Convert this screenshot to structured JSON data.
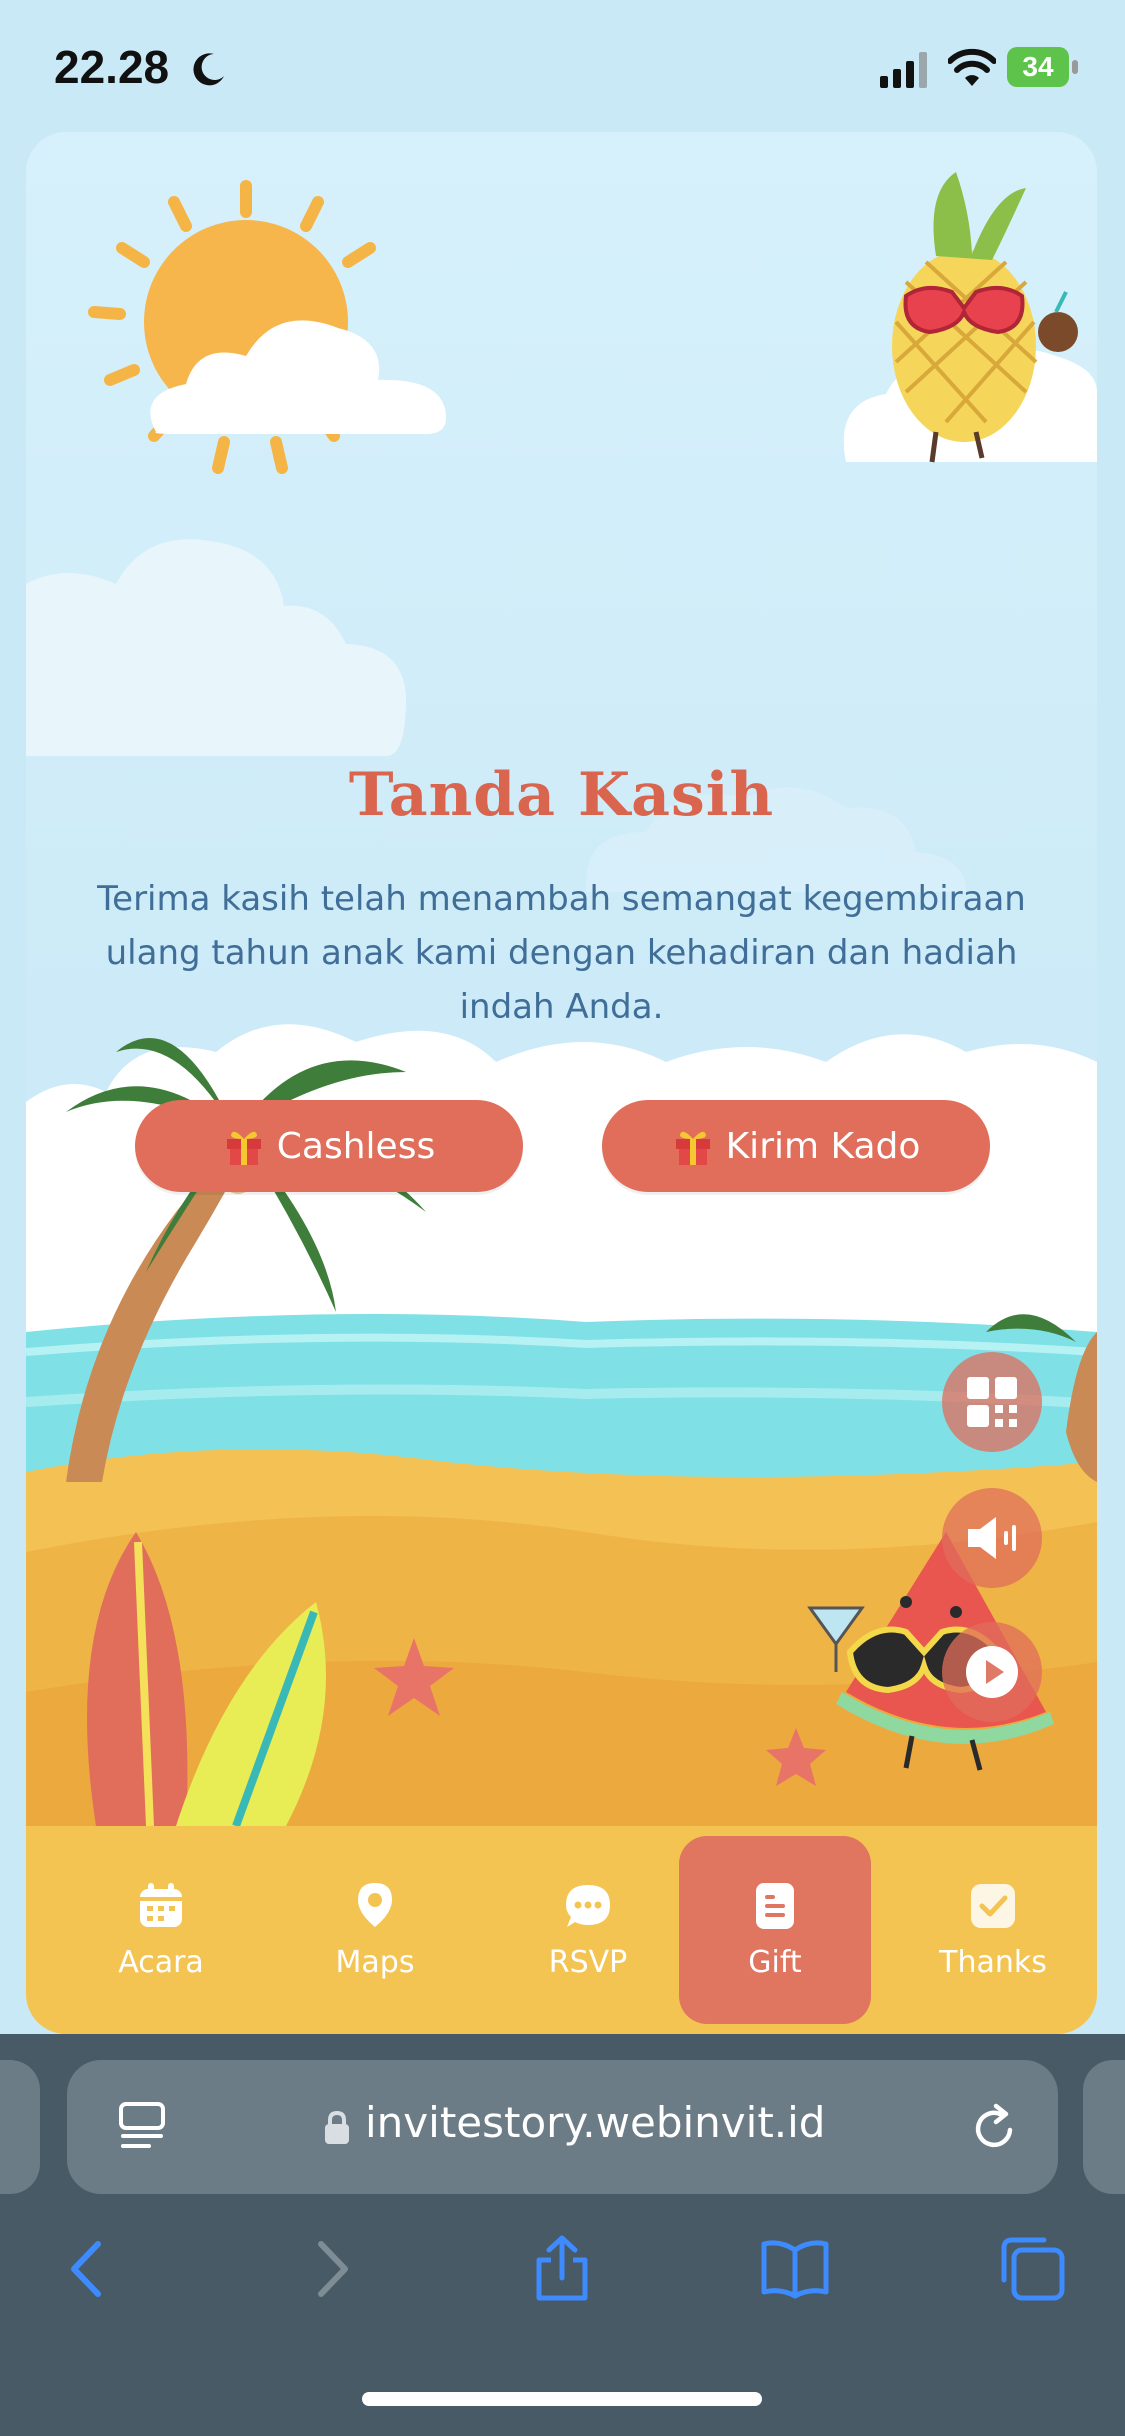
{
  "status_bar": {
    "time": "22.28",
    "battery": "34"
  },
  "invitation": {
    "title": "Tanda Kasih",
    "message": "Terima kasih telah menambah semangat kegembiraan ulang tahun anak kami dengan kehadiran dan hadiah indah Anda.",
    "buttons": {
      "cashless": "Cashless",
      "kirim_kado": "Kirim Kado"
    }
  },
  "floating_controls": [
    "qr-code-icon",
    "speaker-icon",
    "play-icon"
  ],
  "bottom_nav": {
    "items": [
      {
        "label": "Acara",
        "icon": "calendar-icon"
      },
      {
        "label": "Maps",
        "icon": "map-pin-icon"
      },
      {
        "label": "RSVP",
        "icon": "chat-bubble-icon"
      },
      {
        "label": "Gift",
        "icon": "gift-list-icon",
        "active": true
      },
      {
        "label": "Thanks",
        "icon": "check-icon"
      }
    ]
  },
  "browser": {
    "url": "invitestory.webinvit.id"
  },
  "colors": {
    "accent": "#e06e5b",
    "nav_bg": "#f4c452",
    "title": "#d9654f",
    "text": "#3f6e98"
  }
}
